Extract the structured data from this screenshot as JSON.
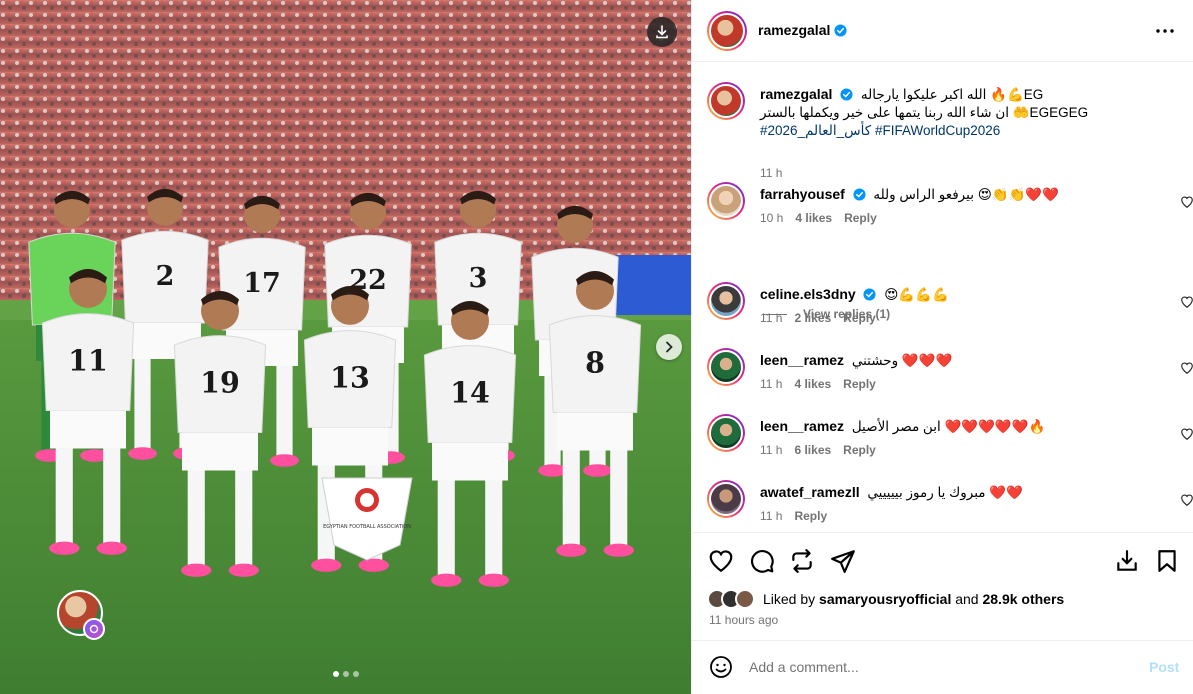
{
  "post": {
    "author": "ramezgalal",
    "author_verified": true
  },
  "caption": {
    "username": "ramezgalal",
    "line1": "الله اكبر عليكوا يارجاله 🔥💪EG",
    "line2": "ان شاء الله ربنا يتمها على خير ويكملها بالستر 🤲EGEGEG",
    "hashtags": "#كأس_العالم_2026 #FIFAWorldCup2026",
    "time": "11 h"
  },
  "comments": [
    {
      "username": "farrahyousef",
      "verified": true,
      "text": "بيرفعو الراس ولله 😍👏👏❤️❤️",
      "time": "10 h",
      "likes": "4 likes",
      "reply": "Reply"
    },
    {
      "username": "celine.els3dny",
      "verified": true,
      "text": "😍💪💪💪",
      "time": "11 h",
      "likes": "2 likes",
      "reply": "Reply"
    },
    {
      "username": "leen__ramez",
      "verified": false,
      "text": "وحشتني ❤️❤️❤️",
      "time": "11 h",
      "likes": "4 likes",
      "reply": "Reply"
    },
    {
      "username": "leen__ramez",
      "verified": false,
      "text": "ابن مصر الأصيل ❤️❤️❤️❤️❤️🔥",
      "time": "11 h",
      "likes": "6 likes",
      "reply": "Reply"
    },
    {
      "username": "awatef_ramezll",
      "verified": false,
      "text": "مبروك يا رموز بيييييي ❤️❤️",
      "time": "11 h",
      "likes": "",
      "reply": "Reply"
    }
  ],
  "view_replies": "View replies (1)",
  "likes": {
    "prefix": "Liked by",
    "user": "samaryousryofficial",
    "and": "and",
    "others": "28.9k others"
  },
  "time_ago": "11 hours ago",
  "comment_input": {
    "placeholder": "Add a comment..."
  },
  "post_button": "Post",
  "jersey_numbers": [
    "2",
    "17",
    "22",
    "3",
    "11",
    "19",
    "13",
    "14",
    "8"
  ],
  "pennant_text": "EGYPTIAN FOOTBALL ASSOCIATION",
  "carousel": {
    "current": 1,
    "total": 3
  },
  "icons": [
    "download-icon",
    "chevron-right-icon",
    "more-icon",
    "verified-icon",
    "heart-icon",
    "comment-icon",
    "share-icon",
    "send-icon",
    "save-icon",
    "bookmark-icon",
    "emoji-icon"
  ],
  "colors": {
    "accent": "#0095f6",
    "link": "#00376b",
    "muted": "#737373",
    "post_disabled": "#b2dffc",
    "pitch": "#4d8f3a",
    "kit": "#f3f3f3",
    "socks_pink": "#ff4f9e"
  }
}
